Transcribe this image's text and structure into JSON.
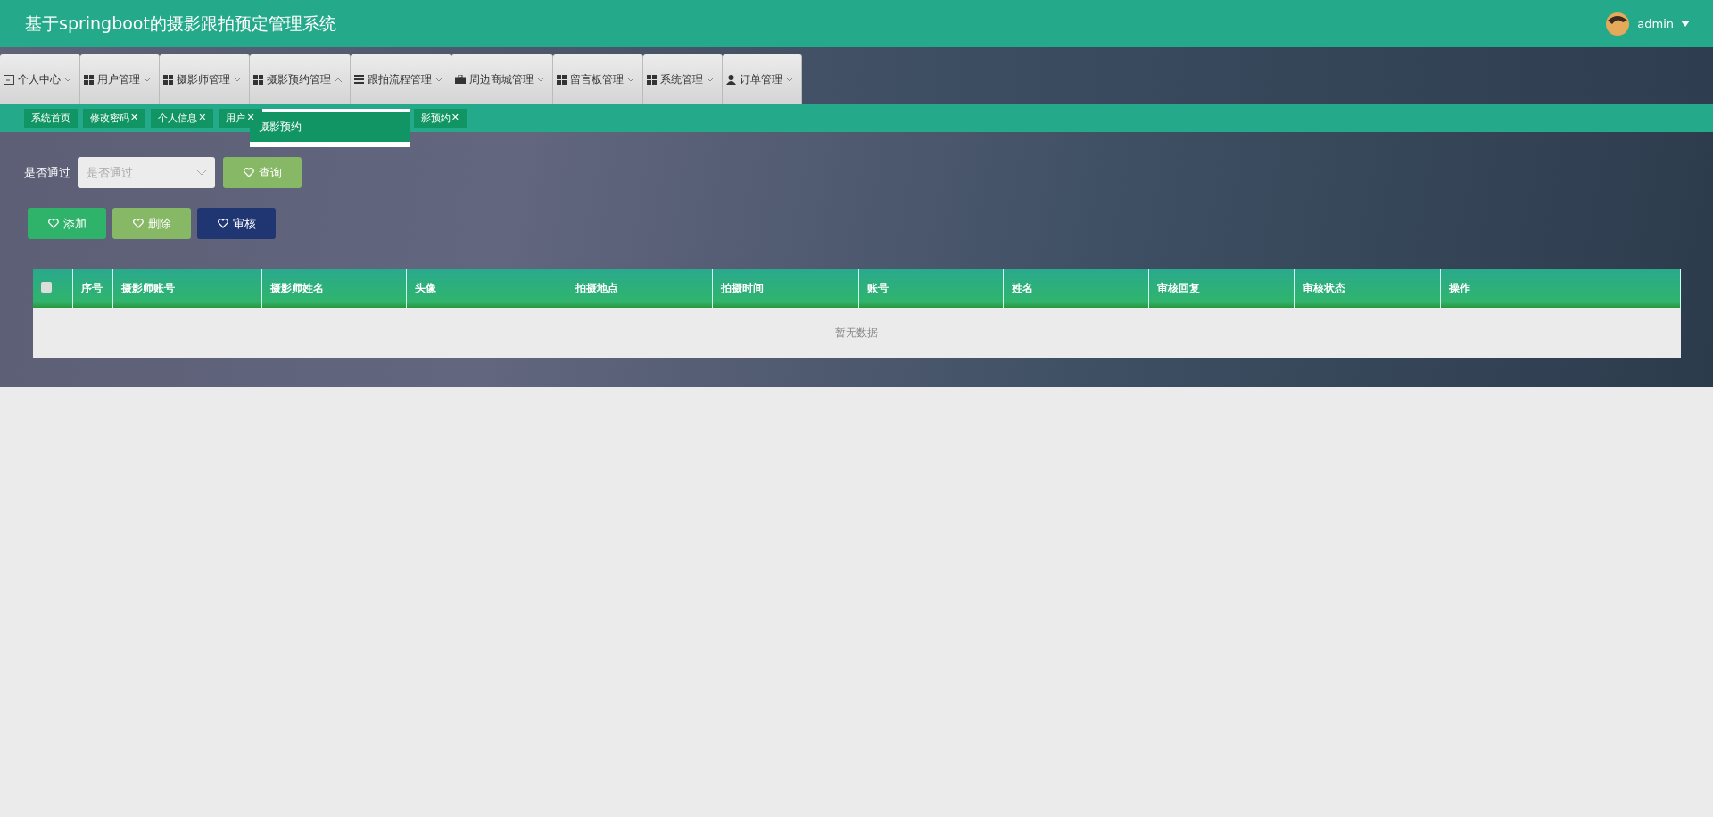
{
  "header": {
    "title": "基于springboot的摄影跟拍预定管理系统",
    "user": "admin"
  },
  "menu": [
    {
      "label": "个人中心",
      "kind": "calendar",
      "expanded": false
    },
    {
      "label": "用户管理",
      "kind": "grid",
      "expanded": false
    },
    {
      "label": "摄影师管理",
      "kind": "grid",
      "expanded": false
    },
    {
      "label": "摄影预约管理",
      "kind": "grid",
      "expanded": true,
      "children": [
        {
          "label": "摄影预约",
          "selected": true
        }
      ]
    },
    {
      "label": "跟拍流程管理",
      "kind": "lines",
      "expanded": false
    },
    {
      "label": "周边商城管理",
      "kind": "briefcase",
      "expanded": false
    },
    {
      "label": "留言板管理",
      "kind": "grid",
      "expanded": false
    },
    {
      "label": "系统管理",
      "kind": "grid",
      "expanded": false
    },
    {
      "label": "订单管理",
      "kind": "person",
      "expanded": false
    }
  ],
  "tabs": [
    {
      "label": "系统首页"
    },
    {
      "label": "修改密码",
      "close": "✕"
    },
    {
      "label": "个人信息",
      "close": "✕"
    },
    {
      "label": "用户",
      "close": "✕"
    },
    {
      "label": "影预约",
      "close": "✕"
    }
  ],
  "filter": {
    "label": "是否通过",
    "placeholder": "是否通过",
    "button": "查询"
  },
  "actions": [
    {
      "label": "添加",
      "color": "#2fb36a"
    },
    {
      "label": "删除",
      "color": "#86b865"
    },
    {
      "label": "审核",
      "color": "#1f3673"
    }
  ],
  "table": {
    "columns": [
      "序号",
      "摄影师账号",
      "摄影师姓名",
      "头像",
      "拍摄地点",
      "拍摄时间",
      "账号",
      "姓名",
      "审核回复",
      "审核状态",
      "操作"
    ],
    "empty": "暂无数据",
    "all_checked": false
  }
}
